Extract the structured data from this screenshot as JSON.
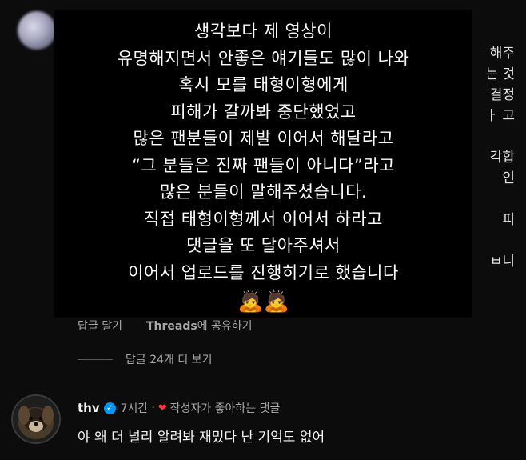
{
  "background_text_fragments": [
    "해주",
    "는 것",
    "결정",
    "ㅏ 고",
    "",
    "각합",
    "인",
    "",
    "피",
    "",
    "ㅂ니"
  ],
  "overlay": {
    "lines": [
      "생각보다 제 영상이",
      "유명해지면서 안좋은 얘기들도 많이 나와",
      "혹시 모를 태형이형에게",
      "피해가 갈까봐 중단했었고",
      "많은 팬분들이 제발 이어서 해달라고",
      "“그 분들은 진짜 팬들이 아니다”라고",
      "많은 분들이 말해주셨습니다.",
      "직접 태형이형께서 이어서 하라고",
      "댓글을 또 달아주셔서",
      "이어서 업로드를 진행히기로 했습니다"
    ],
    "emoji": "🙇🙇"
  },
  "actions": {
    "reply": "답글 달기",
    "share_brand": "Threads",
    "share_suffix": "에 공유하기"
  },
  "more_replies": "답글 24개 더 보기",
  "reply": {
    "username": "thv",
    "verified_icon": "✓",
    "time": "7시간",
    "separator": "·",
    "heart_icon": "❤",
    "liked_by_author": "작성자가 좋아하는 댓글",
    "text": "야 왜 더 널리 알려봐 재밌다 난 기억도 없어"
  },
  "colors": {
    "background": "#0c0c0c",
    "overlay": "#000000",
    "muted_text": "#a8a8a8",
    "verified_blue": "#0095f6",
    "heart_red": "#ff3040"
  }
}
